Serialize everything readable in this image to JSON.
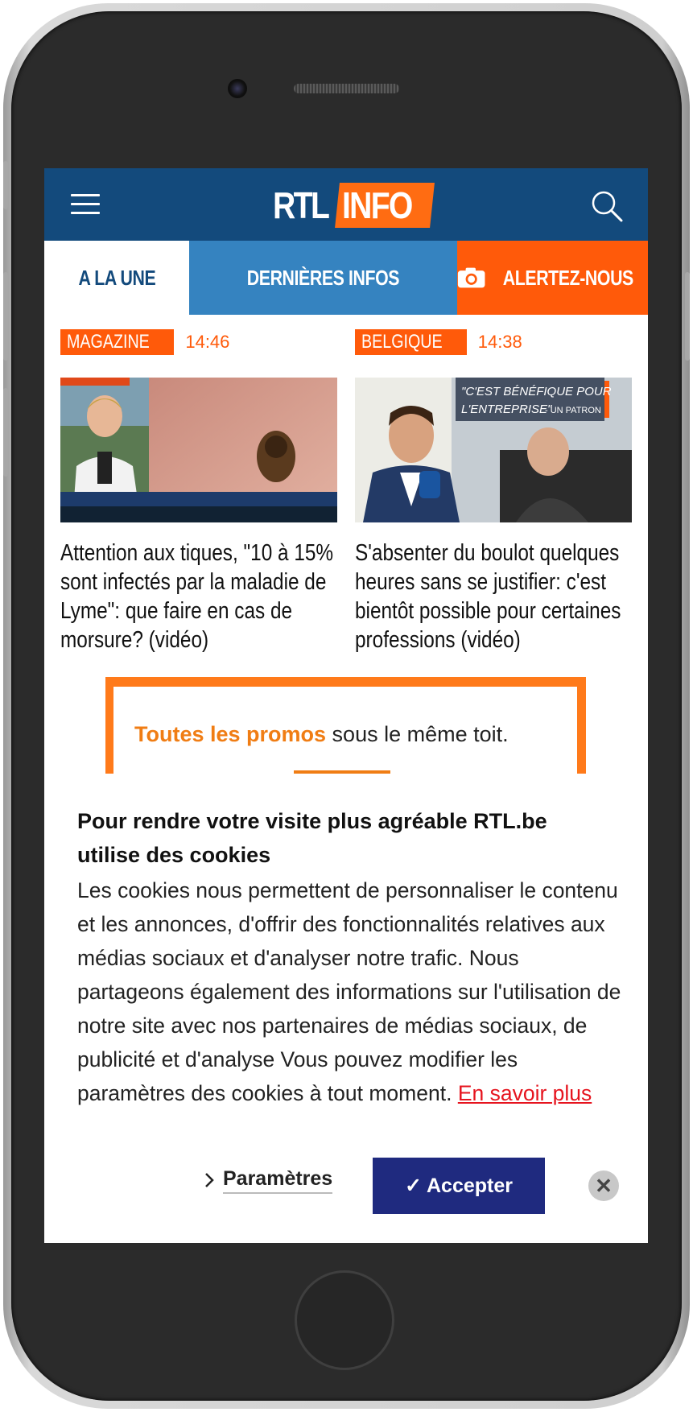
{
  "header": {
    "logo_left": "RTL",
    "logo_right": "INFO",
    "menu_icon": "hamburger-icon",
    "search_icon": "search-icon"
  },
  "tabs": [
    {
      "label": "A LA UNE"
    },
    {
      "label": "DERNIÈRES INFOS"
    },
    {
      "label": "ALERTEZ-NOUS",
      "icon": "camera-icon"
    }
  ],
  "articles": [
    {
      "category": "MAGAZINE",
      "time": "14:46",
      "headline": "Attention aux tiques, \"10 à 15% sont infectés par la maladie de Lyme\": que faire en cas de morsure? (vidéo)"
    },
    {
      "category": "BELGIQUE",
      "time": "14:38",
      "headline": "S'absenter du boulot quelques heures sans se justifier: c'est bientôt possible pour certaines professions (vidéo)",
      "image_caption_1": "\"C'EST BÉNÉFIQUE POUR",
      "image_caption_2": "L'ENTREPRISE\"",
      "image_caption_3": "- UN PATRON"
    }
  ],
  "ad": {
    "highlight": "Toutes les promos",
    "text": " sous le même toit."
  },
  "cookie": {
    "title": "Pour rendre votre visite plus agréable RTL.be utilise des cookies",
    "body": "Les cookies nous permettent de personnaliser le contenu et les annonces, d'offrir des fonctionnalités relatives aux médias sociaux et d'analyser notre trafic. Nous partageons également des informations sur l'utilisation de notre site avec nos partenaires de médias sociaux, de publicité et d'analyse Vous pouvez modifier les paramètres des cookies à tout moment. ",
    "link": "En savoir plus",
    "params_label": "Paramètres",
    "accept_label": "✓ Accepter",
    "close_icon": "close-icon"
  },
  "colors": {
    "brand_blue": "#134a7c",
    "tab_blue": "#3583c0",
    "accent_orange": "#ff5a0a",
    "accept_button": "#1f2a7f"
  }
}
